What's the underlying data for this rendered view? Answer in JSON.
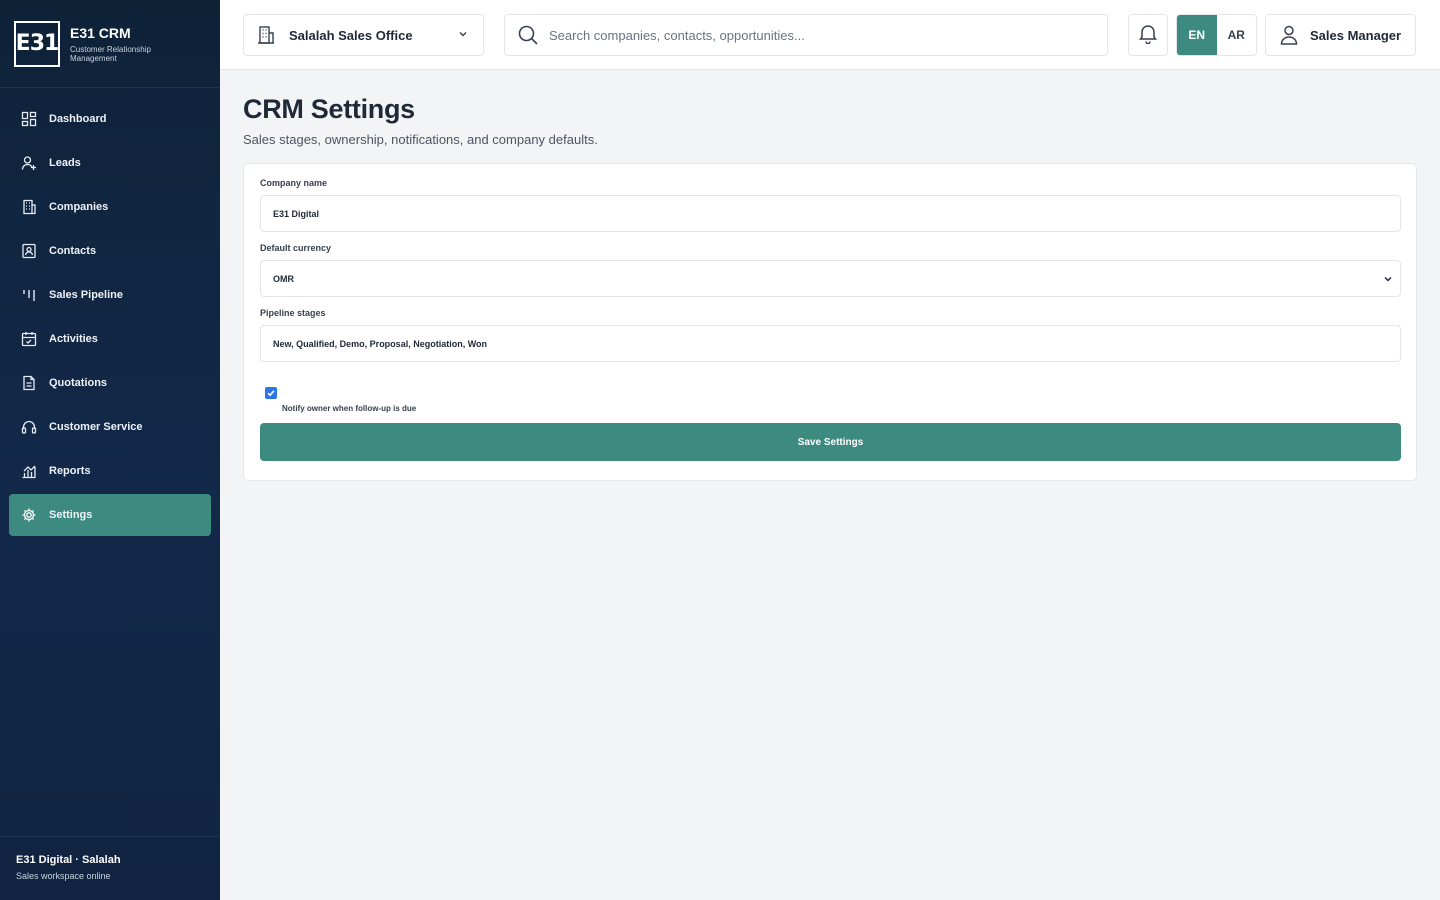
{
  "brand": {
    "logo": "E31",
    "title": "E31 CRM",
    "subtitle": "Customer Relationship Management"
  },
  "sidebar": {
    "items": [
      {
        "label": "Dashboard",
        "icon": "grid-icon"
      },
      {
        "label": "Leads",
        "icon": "user-plus-icon"
      },
      {
        "label": "Companies",
        "icon": "building-icon"
      },
      {
        "label": "Contacts",
        "icon": "contact-card-icon"
      },
      {
        "label": "Sales Pipeline",
        "icon": "pipeline-icon"
      },
      {
        "label": "Activities",
        "icon": "calendar-icon"
      },
      {
        "label": "Quotations",
        "icon": "document-icon"
      },
      {
        "label": "Customer Service",
        "icon": "headset-icon"
      },
      {
        "label": "Reports",
        "icon": "chart-icon"
      },
      {
        "label": "Settings",
        "icon": "gear-icon",
        "active": true
      }
    ],
    "footer": {
      "title": "E31 Digital · Salalah",
      "subtitle": "Sales workspace online"
    }
  },
  "topbar": {
    "office": "Salalah Sales Office",
    "search_placeholder": "Search companies, contacts, opportunities...",
    "lang_en": "EN",
    "lang_ar": "AR",
    "active_lang": "EN",
    "user": "Sales Manager"
  },
  "page": {
    "title": "CRM Settings",
    "subtitle": "Sales stages, ownership, notifications, and company defaults."
  },
  "form": {
    "company_name_label": "Company name",
    "company_name_value": "E31 Digital",
    "currency_label": "Default currency",
    "currency_value": "OMR",
    "stages_label": "Pipeline stages",
    "stages_value": "New, Qualified, Demo, Proposal, Negotiation, Won",
    "notify_checked": true,
    "notify_label": "Notify owner when follow-up is due",
    "save_label": "Save Settings"
  },
  "colors": {
    "accent": "#3d8b80",
    "sidebar_bg": "#13294a",
    "checkbox": "#2f74e6"
  }
}
